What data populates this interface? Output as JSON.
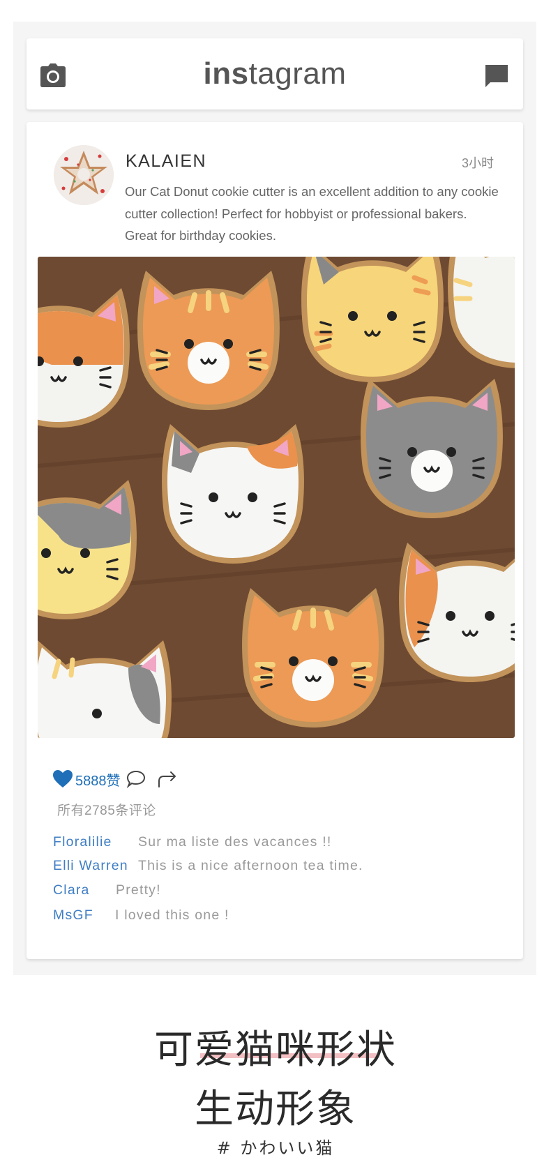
{
  "header": {
    "brand_bold": "ins",
    "brand_rest": "tagram"
  },
  "post": {
    "username": "KALAIEN",
    "time": "3小时",
    "caption": "Our Cat Donut cookie cutter is an excellent addition to any cookie cutter collection! Perfect for hobbyist or professional bakers. Great for birthday cookies.",
    "likes": "5888赞",
    "comments_total": "所有2785条评论",
    "comments": [
      {
        "user": "Floralilie",
        "text": "Sur ma liste des vacances !!"
      },
      {
        "user": "Elli Warren",
        "text": "This is a nice afternoon tea time."
      },
      {
        "user": "Clara",
        "text": "Pretty!"
      },
      {
        "user": "MsGF",
        "text": "I loved this one !"
      }
    ]
  },
  "promo": {
    "line1": "可爱猫咪形状",
    "line2": "生动形象",
    "hashtag": "# かわいい猫"
  },
  "colors": {
    "accent": "#1e6fb8",
    "comment_user": "#3f7ec4",
    "underline": "#f2bfc3"
  },
  "icons": [
    "camera-icon",
    "direct-message-icon",
    "heart-icon",
    "comment-icon",
    "share-icon"
  ]
}
